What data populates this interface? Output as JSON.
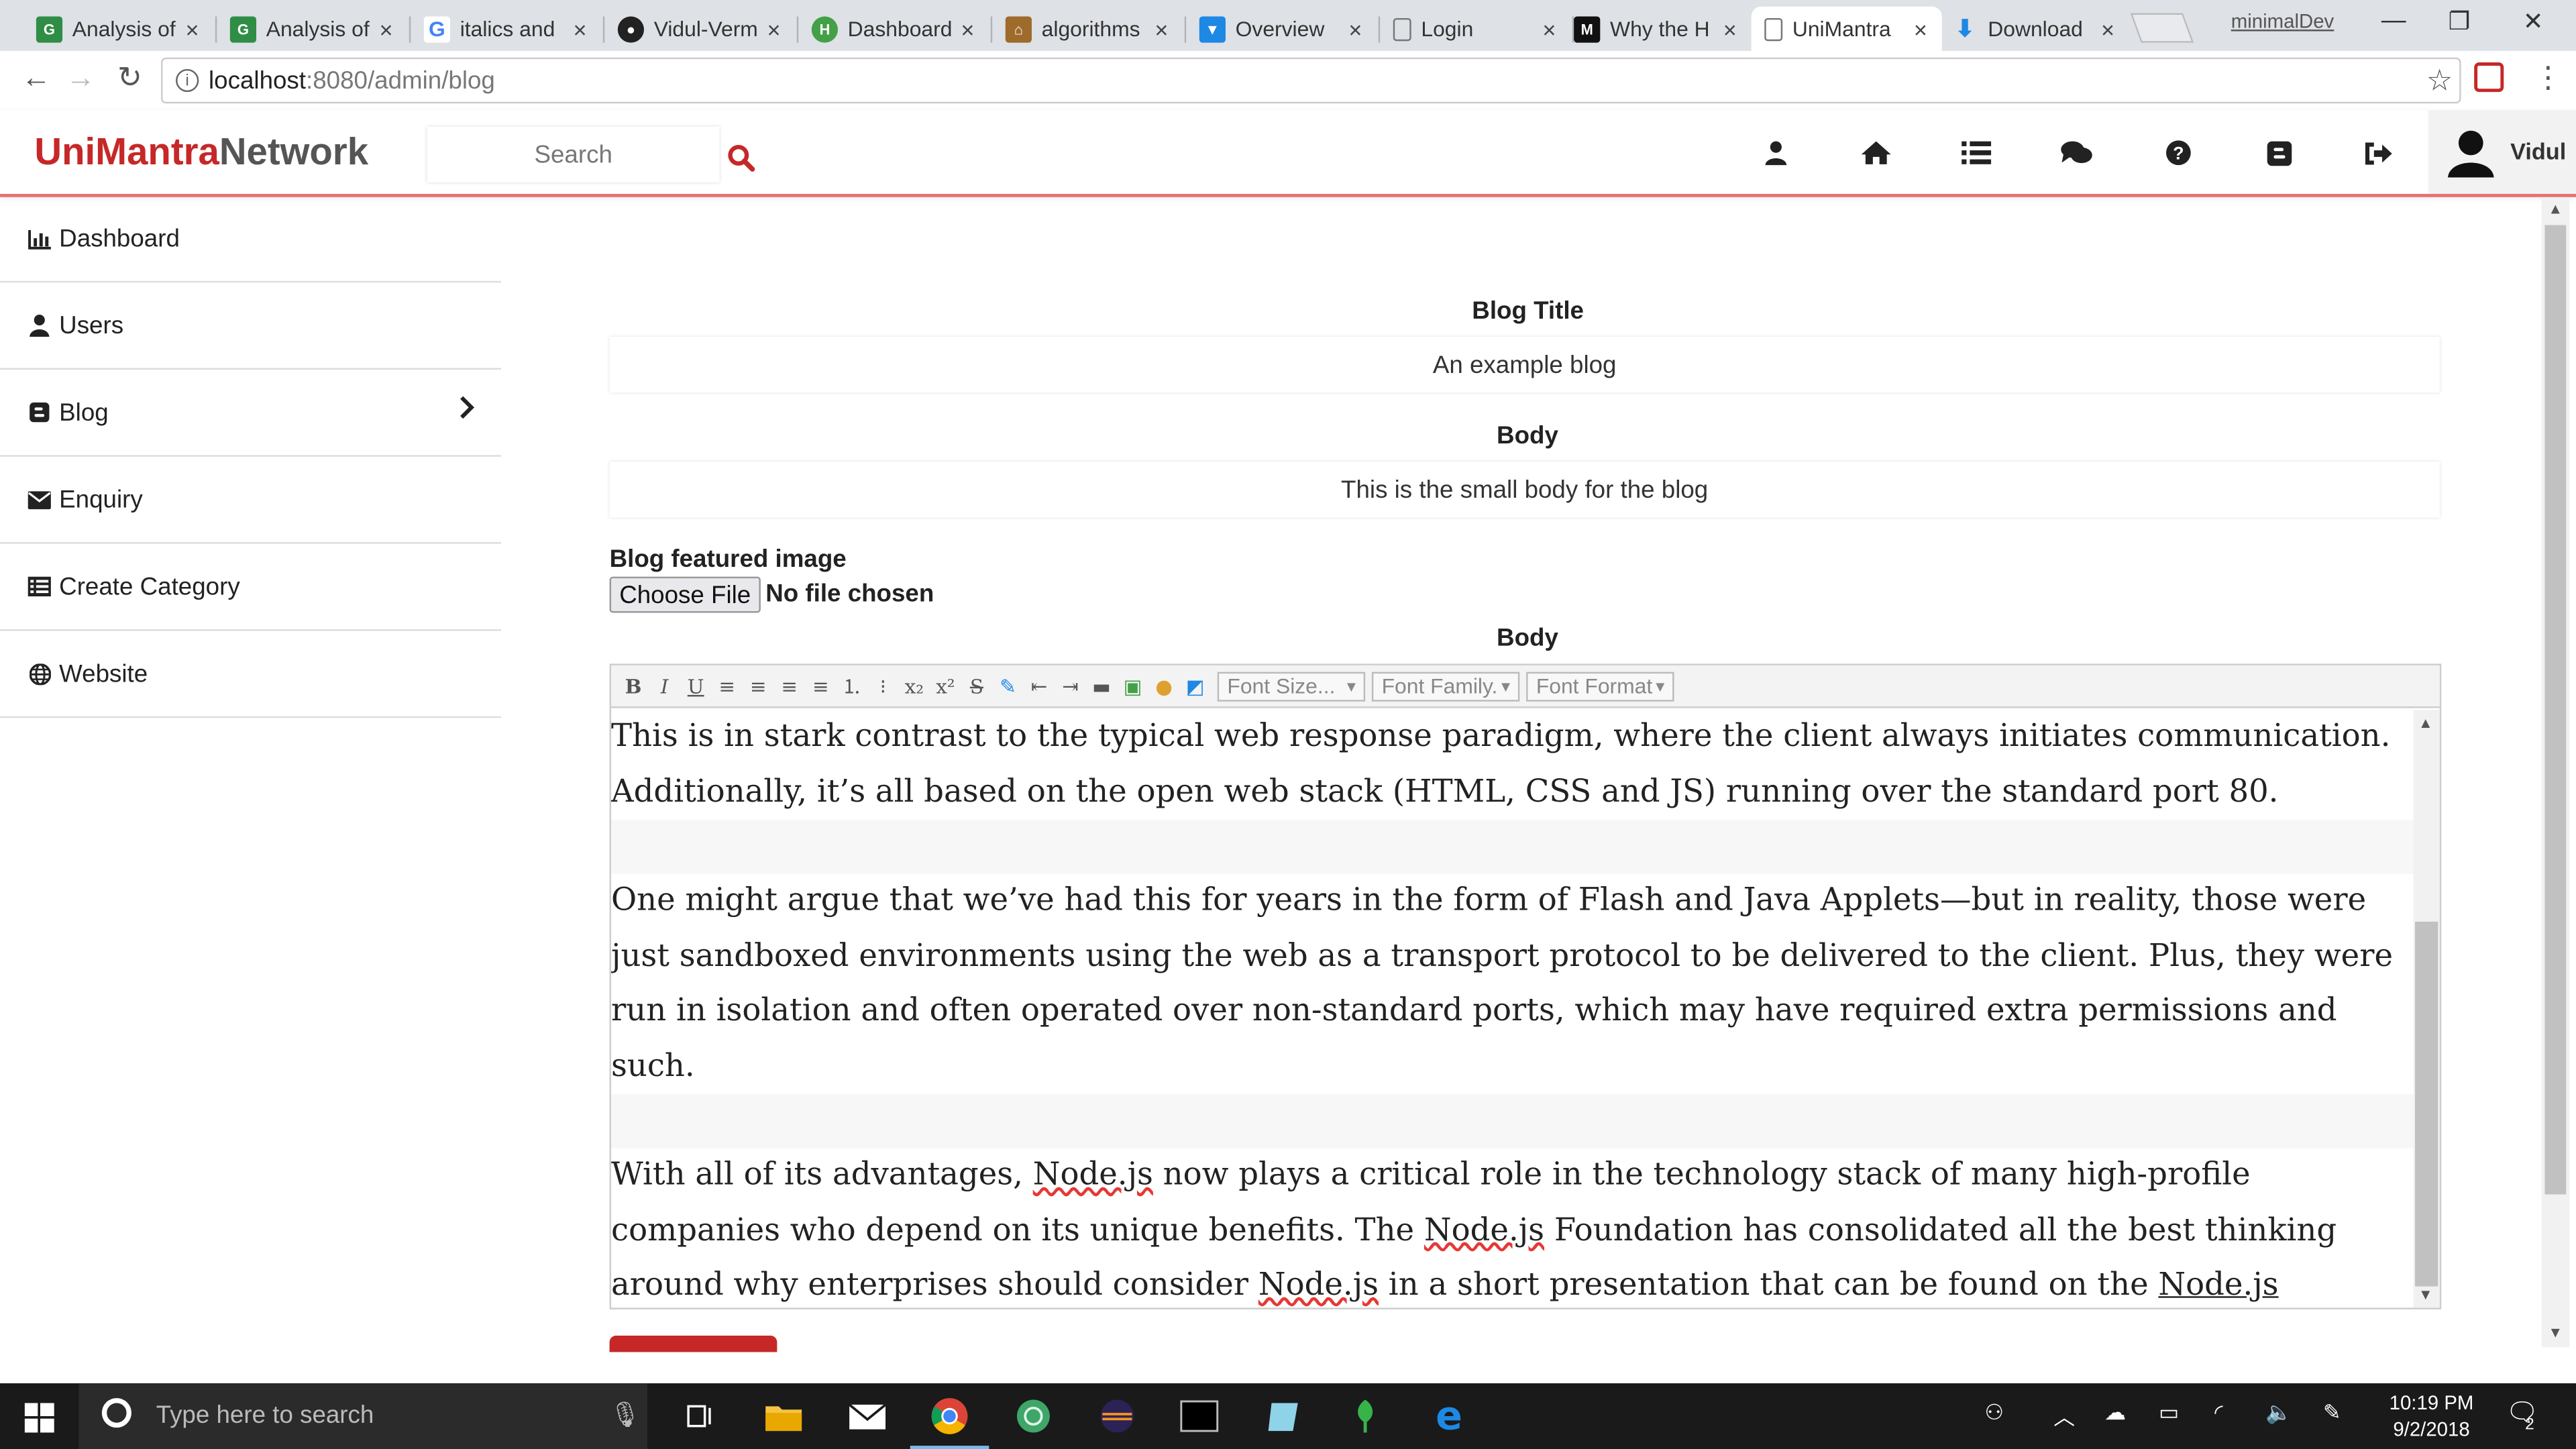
{
  "browser": {
    "tabs": [
      {
        "title": "Analysis of",
        "icon": "geeksforgeeks-icon",
        "color": "#2f8d46"
      },
      {
        "title": "Analysis of",
        "icon": "geeksforgeeks-icon",
        "color": "#2f8d46"
      },
      {
        "title": "italics and",
        "icon": "google-icon",
        "color": "#4285f4"
      },
      {
        "title": "Vidul-Verm",
        "icon": "github-icon",
        "color": "#222222"
      },
      {
        "title": "Dashboard",
        "icon": "heroku-icon",
        "color": "#43a047"
      },
      {
        "title": "algorithms",
        "icon": "stackexchange-icon",
        "color": "#9e6b2b"
      },
      {
        "title": "Overview",
        "icon": "shield-icon",
        "color": "#1e88e5"
      },
      {
        "title": "Login",
        "icon": "page-icon",
        "color": "#777777"
      },
      {
        "title": "Why the H",
        "icon": "medium-icon",
        "color": "#111111"
      },
      {
        "title": "UniMantra",
        "icon": "page-icon",
        "color": "#777777"
      },
      {
        "title": "Download",
        "icon": "download-icon",
        "color": "#1e88e5"
      }
    ],
    "profile": "minimalDev",
    "url_host": "localhost",
    "url_path": ":8080/admin/blog"
  },
  "app": {
    "brand_part1": "UniMantra",
    "brand_part2": "Network",
    "search_placeholder": "Search",
    "username": "Vidul",
    "accent_color": "#c62828"
  },
  "sidebar": {
    "items": [
      {
        "label": "Dashboard",
        "icon": "bar-chart-icon"
      },
      {
        "label": "Users",
        "icon": "user-icon"
      },
      {
        "label": "Blog",
        "icon": "blogger-icon"
      },
      {
        "label": "Enquiry",
        "icon": "envelope-icon"
      },
      {
        "label": "Create Category",
        "icon": "list-icon"
      },
      {
        "label": "Website",
        "icon": "globe-icon"
      }
    ]
  },
  "form": {
    "title_label": "Blog Title",
    "title_value": "An example blog",
    "body_label": "Body",
    "body_value": "This is the small body for the blog",
    "image_label": "Blog featured image",
    "choose_file": "Choose File",
    "no_file": "No file chosen",
    "editor_label": "Body"
  },
  "editor": {
    "toolbar_buttons": [
      "B",
      "I",
      "U",
      "≡",
      "≡",
      "≡",
      "≡",
      "1.",
      "•",
      "x₂",
      "x²",
      "S"
    ],
    "font_size": "Font Size...",
    "font_family": "Font Family.",
    "font_format": "Font Format",
    "p1": "This is in stark contrast to the typical web response paradigm, where the client always initiates communication. Additionally, it’s all based on the open web stack (HTML, CSS and JS) running over the standard port 80.",
    "p2": "One might argue that we’ve had this for years in the form of Flash and Java Applets—but in reality, those were just sandboxed environments using the web as a transport protocol to be delivered to the client. Plus, they were run in isolation and often operated over non-standard ports, which may have required extra permissions and such.",
    "p3_a": "With all of its advantages, ",
    "p3_b": "Node.js",
    "p3_c": " now plays a critical role in the technology stack of many high-profile companies who depend on its unique benefits. The ",
    "p3_d": "Node.js",
    "p3_e": " Foundation has consolidated all the best thinking around why enterprises should consider ",
    "p3_f": "Node.js",
    "p3_g": " in a short presentation that can be found on the ",
    "p3_h": "Node.js Foundation’s Case Studies page",
    "p3_i": "."
  },
  "taskbar": {
    "search_placeholder": "Type here to search",
    "time": "10:19 PM",
    "date": "9/2/2018",
    "notif_count": "2"
  }
}
